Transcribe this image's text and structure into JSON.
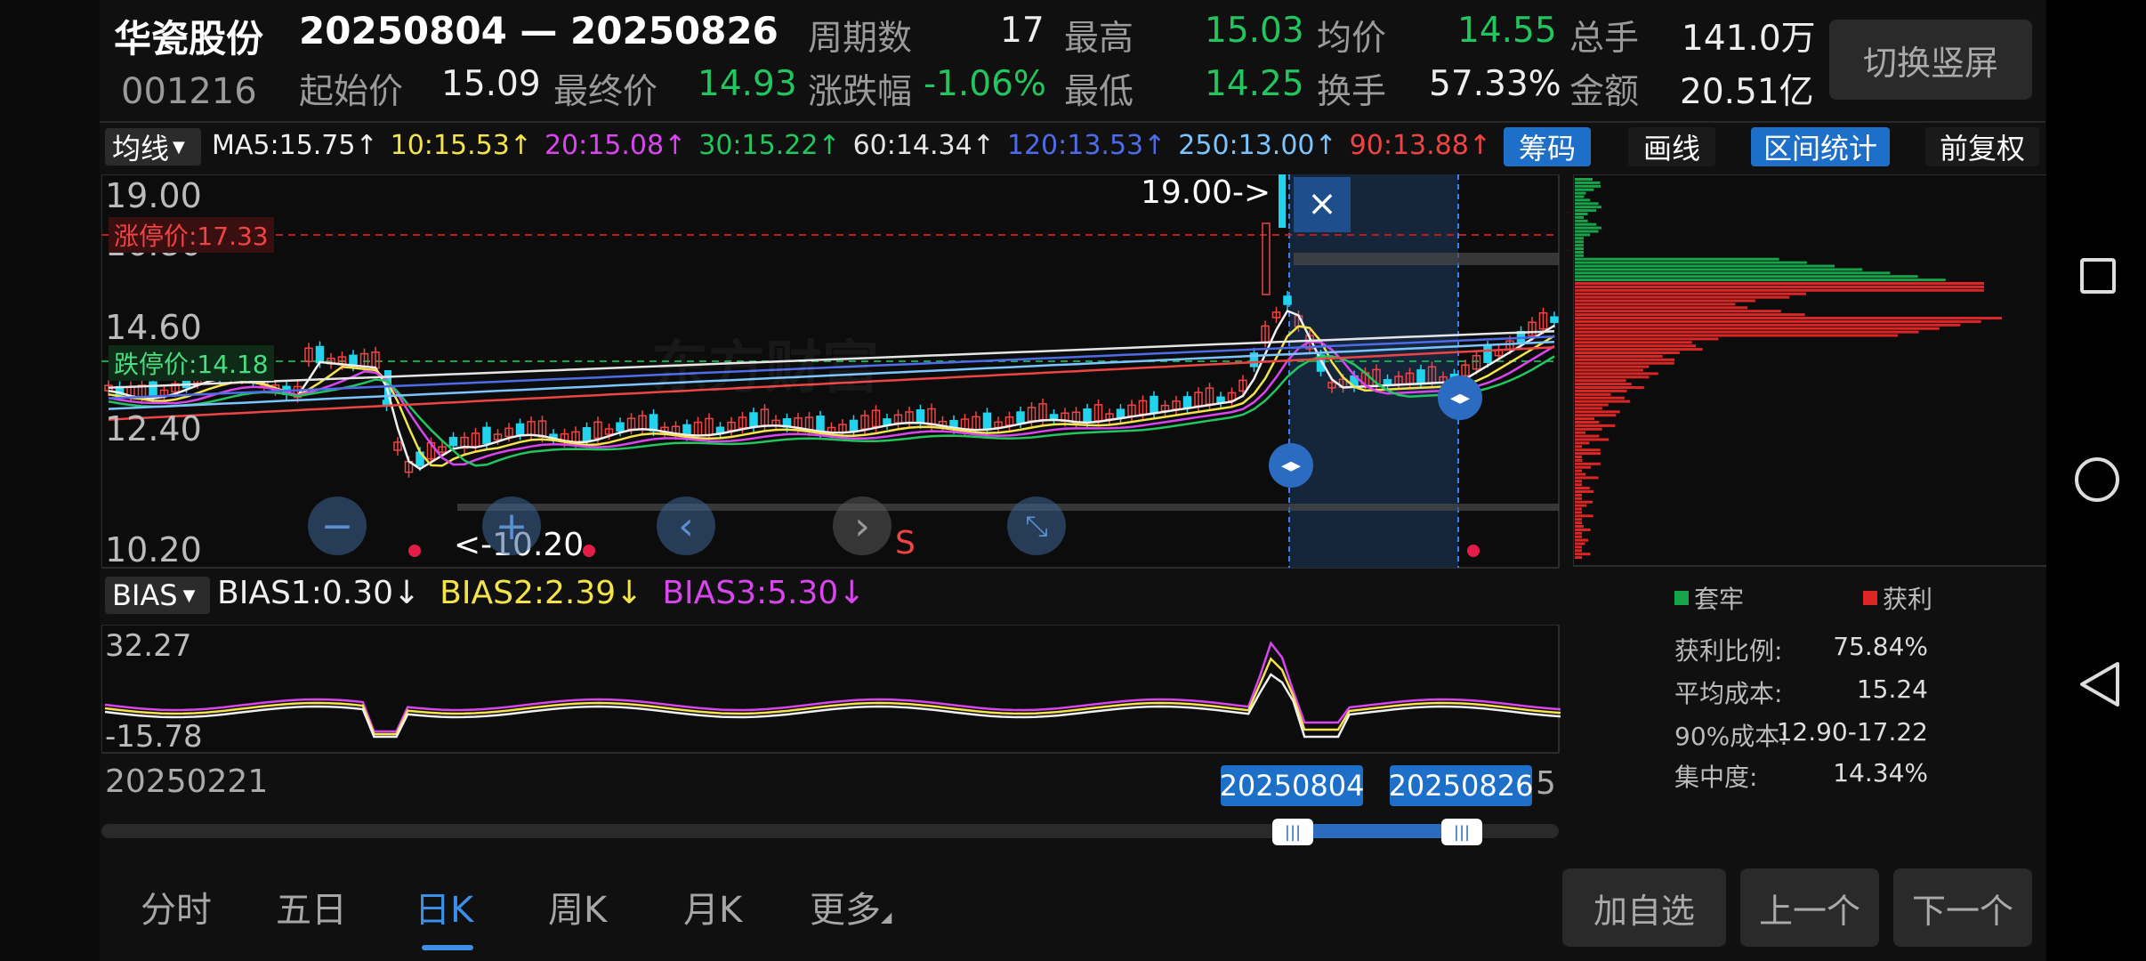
{
  "header": {
    "stock_name": "华瓷股份",
    "stock_code": "001216",
    "date_range": "20250804 — 20250826",
    "start_label": "起始价",
    "start_value": "15.09",
    "end_label": "最终价",
    "end_value": "14.93",
    "period_label": "周期数",
    "period_value": "17",
    "change_label": "涨跌幅",
    "change_value": "-1.06%",
    "high_label": "最高",
    "high_value": "15.03",
    "low_label": "最低",
    "low_value": "14.25",
    "avg_label": "均价",
    "avg_value": "14.55",
    "turnover_label": "换手",
    "turnover_value": "57.33%",
    "vol_label": "总手",
    "vol_value": "141.0万",
    "amount_label": "金额",
    "amount_value": "20.51亿",
    "switch_button": "切换竖屏"
  },
  "ma_bar": {
    "selector": "均线",
    "items": [
      {
        "text": "MA5:15.75↑",
        "color": "#f0f0f0"
      },
      {
        "text": "10:15.53↑",
        "color": "#f4e34a"
      },
      {
        "text": "20:15.08↑",
        "color": "#d946ef"
      },
      {
        "text": "30:15.22↑",
        "color": "#22c55e"
      },
      {
        "text": "60:14.34↑",
        "color": "#e5e5e5"
      },
      {
        "text": "120:13.53↑",
        "color": "#4f6ce8"
      },
      {
        "text": "250:13.00↑",
        "color": "#7cc4ff"
      },
      {
        "text": "90:13.88↑",
        "color": "#ef4444"
      }
    ],
    "buttons": [
      "筹码",
      "画线",
      "区间统计",
      "前复权"
    ]
  },
  "main_chart": {
    "y_labels": [
      "19.00",
      "16.80",
      "14.60",
      "12.40",
      "10.20"
    ],
    "limit_up": "涨停价:17.33",
    "limit_down": "跌停价:14.18",
    "high_marker": "19.00->",
    "low_marker": "<-10.20",
    "s_marker": "S",
    "close_icon": "×",
    "watermark": "东方财富"
  },
  "bias": {
    "selector": "BIAS",
    "items": [
      {
        "text": "BIAS1:0.30↓",
        "color": "#f0f0f0"
      },
      {
        "text": "BIAS2:2.39↓",
        "color": "#f4e34a"
      },
      {
        "text": "BIAS3:5.30↓",
        "color": "#d946ef"
      }
    ],
    "y_top": "32.27",
    "y_bottom": "-15.78"
  },
  "timeline": {
    "start_date": "20250221",
    "tag_start": "20250804",
    "tag_end": "20250826",
    "tail_char": "5"
  },
  "chips": {
    "legend_trapped": "套牢",
    "legend_profit": "获利",
    "stats": [
      {
        "label": "获利比例:",
        "value": "75.84%"
      },
      {
        "label": "平均成本:",
        "value": "15.24"
      },
      {
        "label": "90%成本:",
        "value": "12.90-17.22"
      },
      {
        "label": "集中度:",
        "value": "14.34%"
      }
    ]
  },
  "tabs": [
    "分时",
    "五日",
    "日K",
    "周K",
    "月K",
    "更多"
  ],
  "actions": [
    "加自选",
    "上一个",
    "下一个"
  ]
}
